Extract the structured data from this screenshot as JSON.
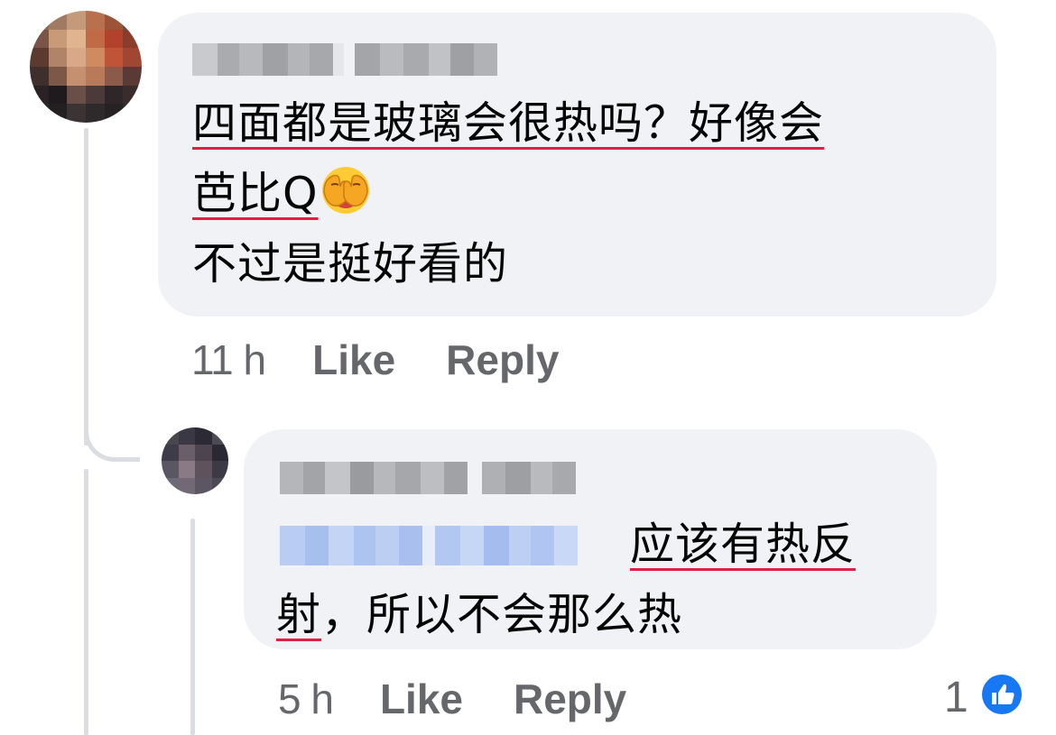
{
  "comment": {
    "text_line1": "四面都是玻璃会很热吗？好像会",
    "text_line2": "芭比Q",
    "text_line3": "不过是挺好看的",
    "time": "11 h",
    "like_label": "Like",
    "reply_label": "Reply"
  },
  "reply": {
    "text_line1": "应该有热反",
    "text_line2_underlined": "射",
    "text_line2_rest": "，所以不会那么热",
    "time": "5 h",
    "like_label": "Like",
    "reply_label": "Reply",
    "reaction_count": "1",
    "reaction_icon": "thumbs-up-icon"
  },
  "colors": {
    "bubble_bg": "#f0f2f5",
    "secondary_text": "#65676b",
    "spellcheck_underline": "#e41e3f",
    "like_blue": "#1877f2"
  }
}
